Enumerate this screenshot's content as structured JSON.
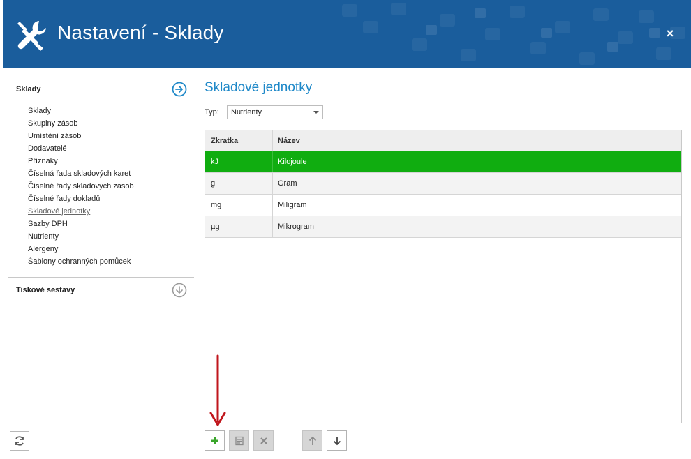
{
  "window": {
    "title": "Nastavení - Sklady",
    "close_label": "×"
  },
  "sidebar": {
    "sections": [
      {
        "title": "Sklady",
        "items": [
          "Sklady",
          "Skupiny zásob",
          "Umístění zásob",
          "Dodavatelé",
          "Příznaky",
          "Číselná řada skladových karet",
          "Číselné řady skladových zásob",
          "Číselné řady dokladů",
          "Skladové jednotky",
          "Sazby DPH",
          "Nutrienty",
          "Alergeny",
          "Šablony ochranných pomůcek"
        ],
        "active_item": "Skladové jednotky"
      },
      {
        "title": "Tiskové sestavy"
      }
    ]
  },
  "main": {
    "title": "Skladové jednotky",
    "filter": {
      "label": "Typ:",
      "value": "Nutrienty"
    },
    "table": {
      "columns": [
        "Zkratka",
        "Název"
      ],
      "rows": [
        {
          "abbr": "kJ",
          "name": "Kilojoule",
          "selected": true
        },
        {
          "abbr": "g",
          "name": "Gram",
          "selected": false
        },
        {
          "abbr": "mg",
          "name": "Miligram",
          "selected": false
        },
        {
          "abbr": "µg",
          "name": "Mikrogram",
          "selected": false
        }
      ]
    },
    "toolbar": {
      "buttons": [
        {
          "icon": "plus-icon",
          "enabled": true
        },
        {
          "icon": "edit-icon",
          "enabled": false
        },
        {
          "icon": "delete-icon",
          "enabled": false
        },
        {
          "icon": "arrow-up-icon",
          "enabled": false
        },
        {
          "icon": "arrow-down-icon",
          "enabled": true
        }
      ]
    }
  },
  "colors": {
    "header": "#1a5d9c",
    "accent": "#1e88c8",
    "selected_row": "#10ad10",
    "annotation_arrow": "#c0161c"
  }
}
